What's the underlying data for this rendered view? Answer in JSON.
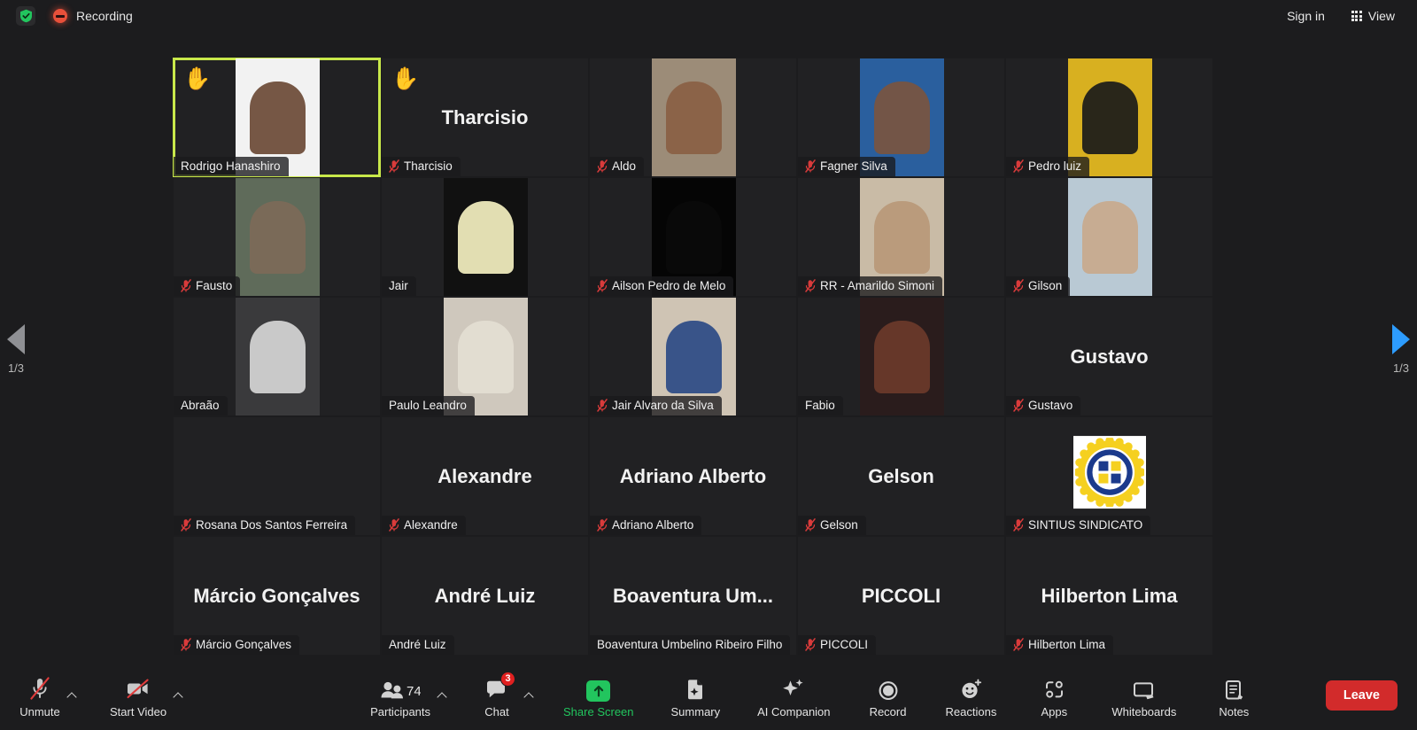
{
  "topbar": {
    "shield_icon": "shield-check-icon",
    "recording_label": "Recording",
    "sign_in_label": "Sign in",
    "view_label": "View",
    "view_icon": "grid-view-icon"
  },
  "pager": {
    "left_icon": "chevron-left-page-icon",
    "right_icon": "chevron-right-page-icon",
    "left_label": "1/3",
    "right_label": "1/3"
  },
  "gallery": {
    "active_border_color": "#c8e84a",
    "mute_icon_color": "#d93b3b",
    "participants": [
      {
        "name": "Rodrigo Hanashiro",
        "muted": false,
        "hand_raised": true,
        "active": true,
        "video": true,
        "letterbox": "#f2f2f2",
        "skin": "#6b4a36"
      },
      {
        "name": "Tharcisio",
        "muted": true,
        "hand_raised": true,
        "active": false,
        "video": false
      },
      {
        "name": "Aldo",
        "muted": true,
        "hand_raised": false,
        "active": false,
        "video": true,
        "letterbox": "#9c8c78",
        "skin": "#8a5f44"
      },
      {
        "name": "Fagner Silva",
        "muted": true,
        "hand_raised": false,
        "active": false,
        "video": true,
        "letterbox": "#2a5f9e",
        "skin": "#7a5540"
      },
      {
        "name": "Pedro luiz",
        "muted": true,
        "hand_raised": false,
        "active": false,
        "video": true,
        "letterbox": "#d8b020",
        "skin": "#1a1a1a"
      },
      {
        "name": "Fausto",
        "muted": true,
        "hand_raised": false,
        "active": false,
        "video": true,
        "letterbox": "#5f6b5a",
        "skin": "#7d6a58"
      },
      {
        "name": "Jair",
        "muted": false,
        "hand_raised": false,
        "active": false,
        "video": true,
        "letterbox": "#111111",
        "skin": "#f4f0c0"
      },
      {
        "name": "Ailson Pedro de Melo",
        "muted": true,
        "hand_raised": false,
        "active": false,
        "video": true,
        "letterbox": "#050505",
        "skin": "#0a0a0a"
      },
      {
        "name": "RR - Amarildo Simoni",
        "muted": true,
        "hand_raised": false,
        "active": false,
        "video": true,
        "letterbox": "#c9bba6",
        "skin": "#b89878"
      },
      {
        "name": "Gilson",
        "muted": true,
        "hand_raised": false,
        "active": false,
        "video": true,
        "letterbox": "#b9c9d4",
        "skin": "#c8a98c"
      },
      {
        "name": "Abraão",
        "muted": false,
        "hand_raised": false,
        "active": false,
        "video": true,
        "letterbox": "#3a3a3c",
        "skin": "#d6d6d6"
      },
      {
        "name": "Paulo Leandro",
        "muted": false,
        "hand_raised": false,
        "active": false,
        "video": true,
        "letterbox": "#cfc8bd",
        "skin": "#e4ded3"
      },
      {
        "name": "Jair Alvaro da Silva",
        "muted": true,
        "hand_raised": false,
        "active": false,
        "video": true,
        "letterbox": "#cfc4b4",
        "skin": "#2c4a86"
      },
      {
        "name": "Fabio",
        "muted": false,
        "hand_raised": false,
        "active": false,
        "video": true,
        "letterbox": "#2a1c1c",
        "skin": "#6b3a2a"
      },
      {
        "name": "Gustavo",
        "muted": true,
        "hand_raised": false,
        "active": false,
        "video": false
      },
      {
        "name": "Rosana Dos Santos Ferreira",
        "muted": true,
        "hand_raised": false,
        "active": false,
        "video": false,
        "no_label": true
      },
      {
        "name": "Alexandre",
        "muted": true,
        "hand_raised": false,
        "active": false,
        "video": false
      },
      {
        "name": "Adriano Alberto",
        "muted": true,
        "hand_raised": false,
        "active": false,
        "video": false
      },
      {
        "name": "Gelson",
        "muted": true,
        "hand_raised": false,
        "active": false,
        "video": false
      },
      {
        "name": "SINTIUS SINDICATO",
        "muted": true,
        "hand_raised": false,
        "active": false,
        "video": false,
        "logo": "sintius-union-logo"
      },
      {
        "name": "Márcio Gonçalves",
        "muted": true,
        "hand_raised": false,
        "active": false,
        "video": false
      },
      {
        "name": "André Luiz",
        "muted": false,
        "hand_raised": false,
        "active": false,
        "video": false
      },
      {
        "name": "Boaventura Umbelino Ribeiro Filho",
        "display_name": "Boaventura Um...",
        "muted": false,
        "hand_raised": false,
        "active": false,
        "video": false
      },
      {
        "name": "PICCOLI",
        "muted": true,
        "hand_raised": false,
        "active": false,
        "video": false
      },
      {
        "name": "Hilberton Lima",
        "muted": true,
        "hand_raised": false,
        "active": false,
        "video": false
      }
    ]
  },
  "toolbar": {
    "unmute": {
      "label": "Unmute",
      "icon": "microphone-muted-icon",
      "has_caret": true
    },
    "start_video": {
      "label": "Start Video",
      "icon": "camera-off-icon",
      "has_caret": true
    },
    "participants": {
      "label": "Participants",
      "icon": "people-icon",
      "count": "74",
      "has_caret": true
    },
    "chat": {
      "label": "Chat",
      "icon": "chat-bubble-icon",
      "badge": "3",
      "has_caret": true
    },
    "share_screen": {
      "label": "Share Screen",
      "icon": "share-screen-up-arrow-icon",
      "accent": "#22c55e"
    },
    "summary": {
      "label": "Summary",
      "icon": "summary-document-icon"
    },
    "ai_companion": {
      "label": "AI Companion",
      "icon": "sparkles-icon"
    },
    "record": {
      "label": "Record",
      "icon": "record-circle-icon"
    },
    "reactions": {
      "label": "Reactions",
      "icon": "smiley-plus-icon"
    },
    "apps": {
      "label": "Apps",
      "icon": "apps-icon"
    },
    "whiteboards": {
      "label": "Whiteboards",
      "icon": "whiteboard-icon"
    },
    "notes": {
      "label": "Notes",
      "icon": "notes-icon"
    },
    "leave": {
      "label": "Leave",
      "color": "#d22b2b"
    }
  }
}
